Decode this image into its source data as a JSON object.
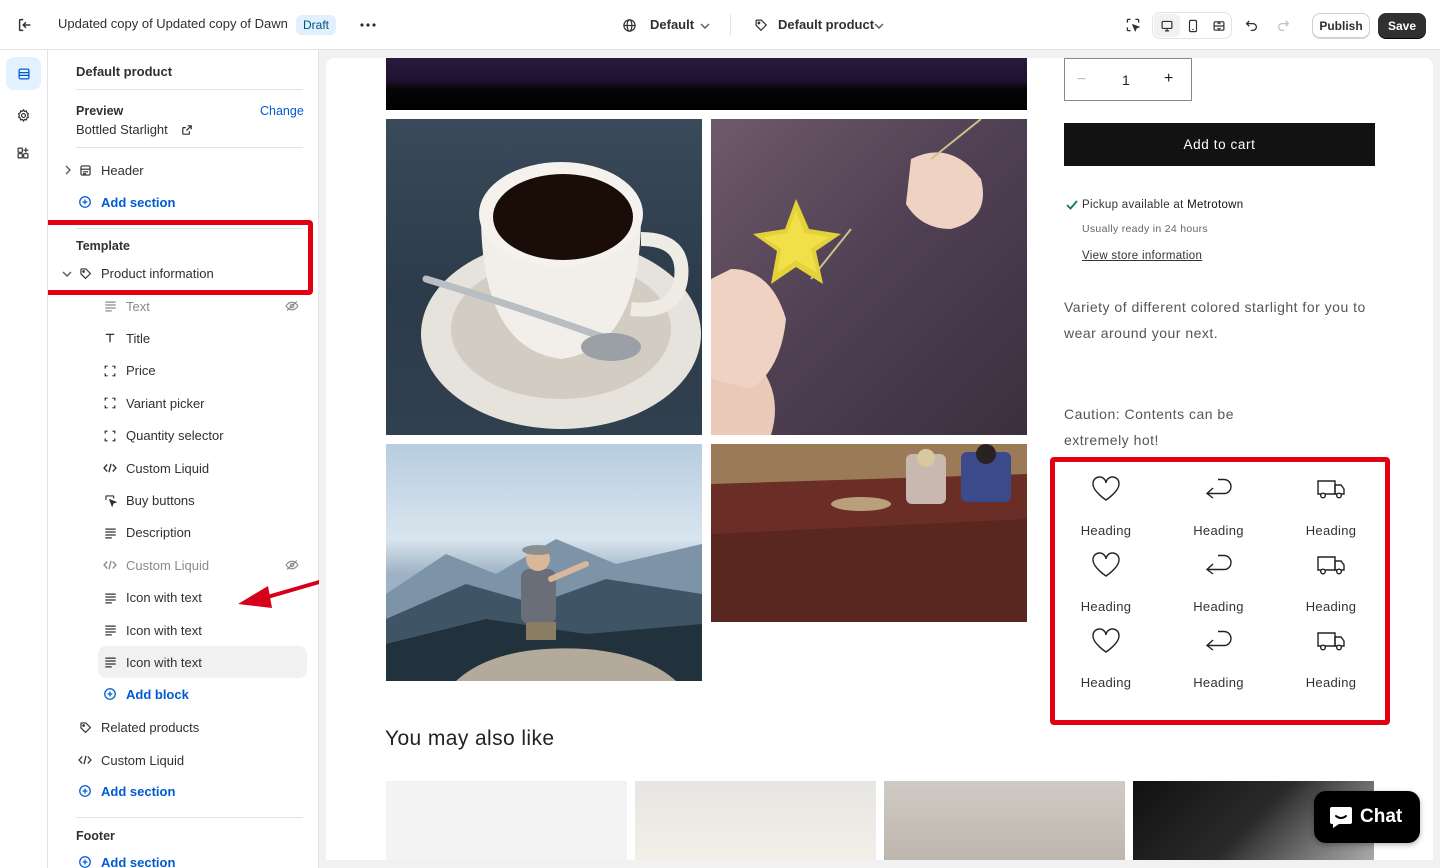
{
  "topbar": {
    "theme_name": "Updated copy of Updated copy of Dawn",
    "status_badge": "Draft",
    "market_selector": "Default",
    "template_selector": "Default product",
    "publish_label": "Publish",
    "save_label": "Save"
  },
  "sidebar": {
    "heading": "Default product",
    "preview_label": "Preview",
    "preview_change": "Change",
    "preview_product": "Bottled Starlight",
    "header_label": "Header",
    "add_section_1": "Add section",
    "template_label": "Template",
    "product_information": "Product information",
    "blocks": [
      {
        "label": "Text",
        "icon": "text-lines-icon",
        "hidden": true
      },
      {
        "label": "Title",
        "icon": "title-t-icon",
        "hidden": false
      },
      {
        "label": "Price",
        "icon": "frame-icon",
        "hidden": false
      },
      {
        "label": "Variant picker",
        "icon": "frame-icon",
        "hidden": false
      },
      {
        "label": "Quantity selector",
        "icon": "frame-icon",
        "hidden": false
      },
      {
        "label": "Custom Liquid",
        "icon": "code-icon",
        "hidden": false
      },
      {
        "label": "Buy buttons",
        "icon": "cursor-icon",
        "hidden": false
      },
      {
        "label": "Description",
        "icon": "text-lines-icon",
        "hidden": false
      },
      {
        "label": "Custom Liquid",
        "icon": "code-icon",
        "hidden": true
      },
      {
        "label": "Icon with text",
        "icon": "text-lines-icon",
        "hidden": false
      },
      {
        "label": "Icon with text",
        "icon": "text-lines-icon",
        "hidden": false
      },
      {
        "label": "Icon with text",
        "icon": "text-lines-icon",
        "hidden": false,
        "selected": true
      }
    ],
    "add_block": "Add block",
    "related_products": "Related products",
    "custom_liquid": "Custom Liquid",
    "add_section_2": "Add section",
    "footer_label": "Footer",
    "add_section_3": "Add section"
  },
  "product": {
    "quantity": "1",
    "add_to_cart": "Add to cart",
    "pickup_prefix": "Pickup available at ",
    "pickup_location": "Metrotown",
    "pickup_ready": "Usually ready in 24 hours",
    "view_store": "View store information",
    "description_line1": "Variety of different colored starlight for you to",
    "description_line2": "wear around your next.",
    "caution_line1": "Caution: Contents can be",
    "caution_line2": "extremely hot!",
    "features": [
      {
        "label": "Heading",
        "icon": "heart-icon"
      },
      {
        "label": "Heading",
        "icon": "return-arrow-icon"
      },
      {
        "label": "Heading",
        "icon": "truck-icon"
      },
      {
        "label": "Heading",
        "icon": "heart-icon"
      },
      {
        "label": "Heading",
        "icon": "return-arrow-icon"
      },
      {
        "label": "Heading",
        "icon": "truck-icon"
      },
      {
        "label": "Heading",
        "icon": "heart-icon"
      },
      {
        "label": "Heading",
        "icon": "return-arrow-icon"
      },
      {
        "label": "Heading",
        "icon": "truck-icon"
      }
    ],
    "related_heading": "You may also like"
  },
  "chat": {
    "label": "Chat"
  },
  "colors": {
    "accent_blue": "#005bd3",
    "annotation_red": "#e0000f",
    "chat_bg": "#000000"
  }
}
